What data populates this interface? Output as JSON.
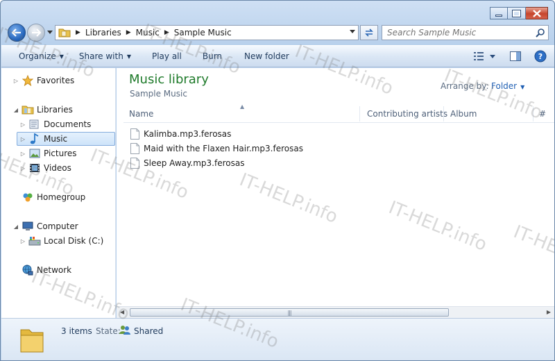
{
  "nav": {
    "breadcrumbs": [
      "Libraries",
      "Music",
      "Sample Music"
    ],
    "search_placeholder": "Search Sample Music"
  },
  "toolbar": {
    "organize": "Organize",
    "share_with": "Share with",
    "play_all": "Play all",
    "burn": "Burn",
    "new_folder": "New folder"
  },
  "sidebar": {
    "favorites": "Favorites",
    "libraries": "Libraries",
    "documents": "Documents",
    "music": "Music",
    "pictures": "Pictures",
    "videos": "Videos",
    "homegroup": "Homegroup",
    "computer": "Computer",
    "local_disk": "Local Disk (C:)",
    "network": "Network"
  },
  "main": {
    "title": "Music library",
    "subtitle": "Sample Music",
    "arrange_label": "Arrange by:",
    "arrange_value": "Folder",
    "columns": [
      "Name",
      "Contributing artists",
      "Album",
      "#"
    ],
    "files": [
      "Kalimba.mp3.ferosas",
      "Maid with the Flaxen Hair.mp3.ferosas",
      "Sleep Away.mp3.ferosas"
    ]
  },
  "details": {
    "count": "3 items",
    "state_label": "State:",
    "state_value": "Shared"
  },
  "watermark": "IT-HELP.info",
  "colors": {
    "accent": "#1e7a2a",
    "link": "#1f5fb3",
    "selection": "#cde3f9"
  }
}
